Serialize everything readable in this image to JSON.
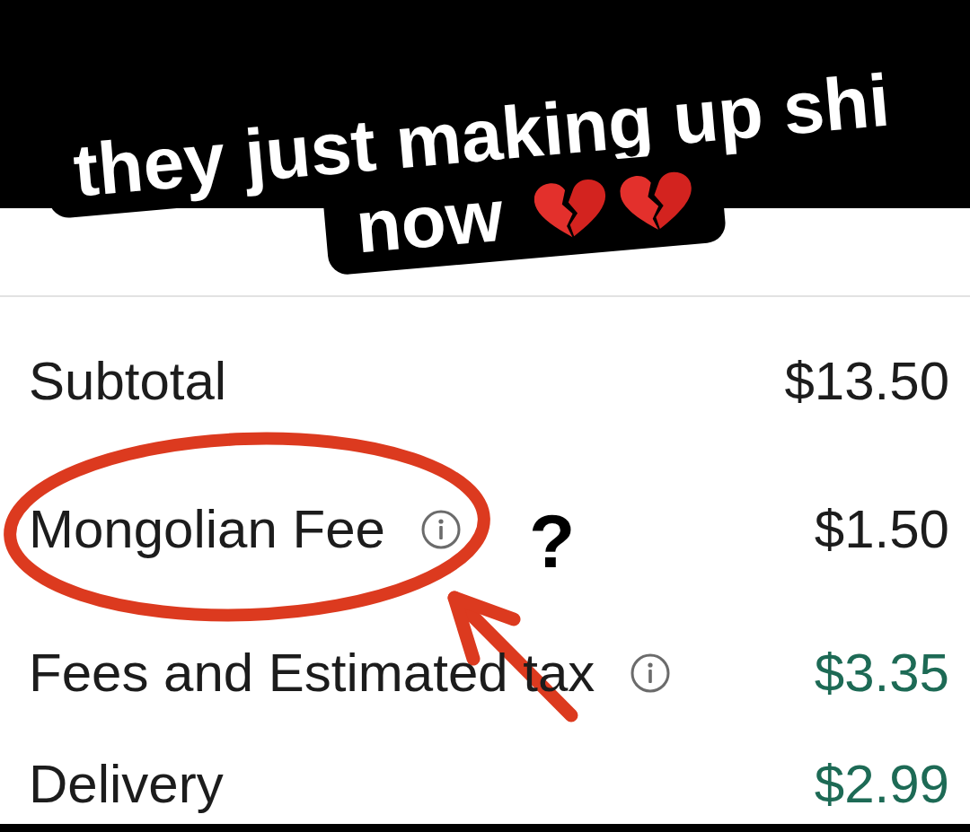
{
  "caption": {
    "lines": [
      {
        "text": "they just making up shi"
      },
      {
        "text": "now",
        "emojis": [
          {
            "kind": "broken_heart"
          },
          {
            "kind": "broken_heart"
          }
        ]
      }
    ]
  },
  "summary": {
    "rows": [
      {
        "label": "Subtotal",
        "info": false,
        "circled": false,
        "value": "$13.50",
        "color": "#1c1c1c"
      },
      {
        "label": "Mongolian Fee",
        "info": true,
        "circled": true,
        "note": "?",
        "value": "$1.50",
        "color": "#1c1c1c"
      },
      {
        "label": "Fees and Estimated tax",
        "info": true,
        "circled": false,
        "value": "$3.35",
        "color": "#1d6a55"
      },
      {
        "label": "Delivery",
        "info": false,
        "circled": false,
        "value": "$2.99",
        "color": "#1d6a55"
      }
    ]
  }
}
